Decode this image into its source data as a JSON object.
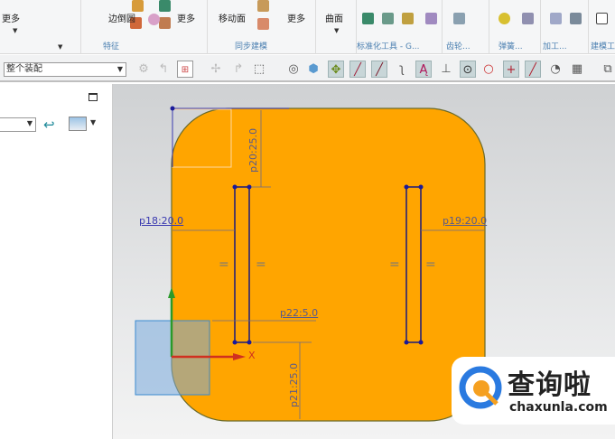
{
  "ribbon": {
    "more1": "更多",
    "more2": "更多",
    "more3": "更多",
    "edge_blend": "边倒圆",
    "move_face": "移动面",
    "surface": "曲面",
    "groups": {
      "feature": "特征",
      "sync_modeling": "同步建模",
      "standard_tools": "标准化工具 - G...",
      "gear": "齿轮...",
      "spring": "弹簧...",
      "machining": "加工...",
      "modeling": "建模工"
    }
  },
  "toolbar": {
    "assembly_filter": "整个装配"
  },
  "sketch": {
    "dim_top": "p20:25.0",
    "dim_left": "p18:20.0",
    "dim_right": "p19:20.0",
    "dim_width": "p22:5.0",
    "dim_bottom": "p21:25.0",
    "axis_x": "X",
    "equal_sign": "=",
    "fill_color": "#FFA500",
    "line_color": "#1A1A7A"
  },
  "watermark": {
    "brand": "查询啦",
    "url": "chaxunla.com"
  }
}
